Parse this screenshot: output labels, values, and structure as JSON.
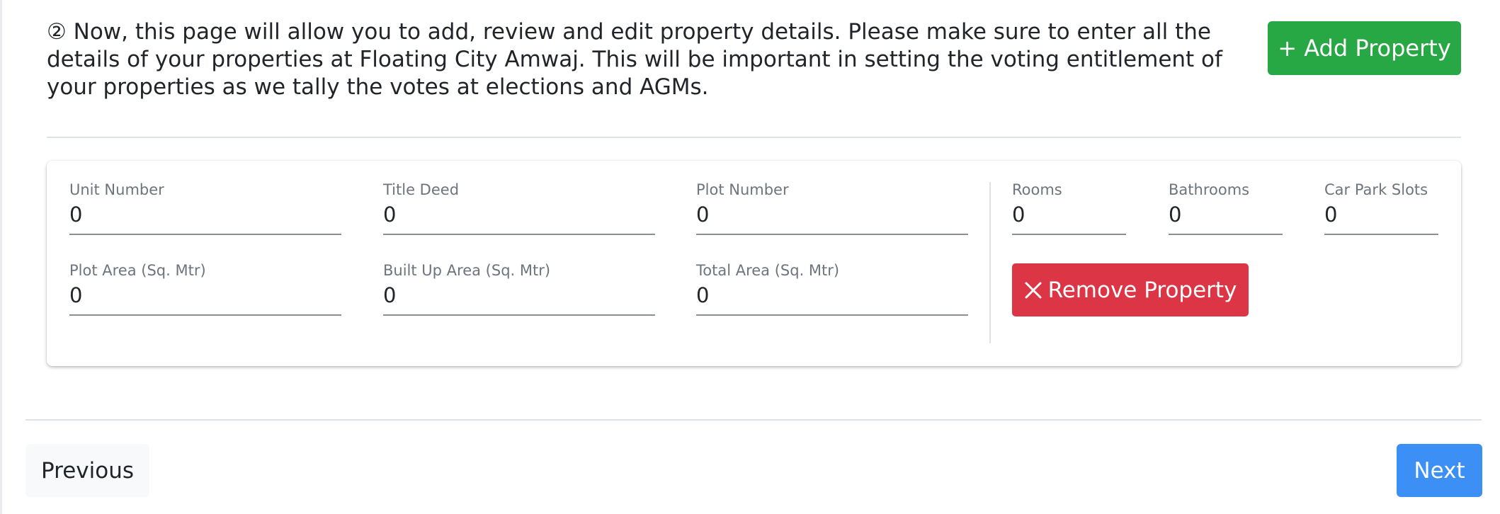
{
  "intro": {
    "text": "② Now, this page will allow you to add, review and edit property details. Please make sure to enter all the details of your properties at Floating City Amwaj. This will be important in setting the voting entitlement of your properties as we tally the votes at elections and AGMs."
  },
  "actions": {
    "add_property_label": "+ Add Property",
    "remove_property_label": "Remove Property",
    "remove_icon": "close-icon"
  },
  "property": {
    "fields": [
      {
        "label": "Unit Number",
        "value": "0"
      },
      {
        "label": "Title Deed",
        "value": "0"
      },
      {
        "label": "Plot Number",
        "value": "0"
      },
      {
        "label": "Rooms",
        "value": "0"
      },
      {
        "label": "Bathrooms",
        "value": "0"
      },
      {
        "label": "Car Park Slots",
        "value": "0"
      },
      {
        "label": "Plot Area (Sq. Mtr)",
        "value": "0"
      },
      {
        "label": "Built Up Area (Sq. Mtr)",
        "value": "0"
      },
      {
        "label": "Total Area (Sq. Mtr)",
        "value": "0"
      }
    ]
  },
  "navigation": {
    "previous_label": "Previous",
    "next_label": "Next"
  },
  "colors": {
    "add_button": "#28a745",
    "remove_button": "#dc3545",
    "next_button": "#3b8ff5",
    "previous_button": "#f8f9fa"
  }
}
